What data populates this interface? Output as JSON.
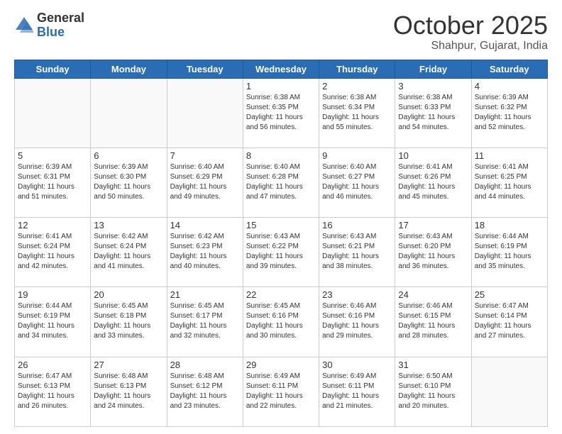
{
  "logo": {
    "general": "General",
    "blue": "Blue"
  },
  "header": {
    "month": "October 2025",
    "location": "Shahpur, Gujarat, India"
  },
  "days_of_week": [
    "Sunday",
    "Monday",
    "Tuesday",
    "Wednesday",
    "Thursday",
    "Friday",
    "Saturday"
  ],
  "weeks": [
    [
      {
        "day": "",
        "info": ""
      },
      {
        "day": "",
        "info": ""
      },
      {
        "day": "",
        "info": ""
      },
      {
        "day": "1",
        "info": "Sunrise: 6:38 AM\nSunset: 6:35 PM\nDaylight: 11 hours\nand 56 minutes."
      },
      {
        "day": "2",
        "info": "Sunrise: 6:38 AM\nSunset: 6:34 PM\nDaylight: 11 hours\nand 55 minutes."
      },
      {
        "day": "3",
        "info": "Sunrise: 6:38 AM\nSunset: 6:33 PM\nDaylight: 11 hours\nand 54 minutes."
      },
      {
        "day": "4",
        "info": "Sunrise: 6:39 AM\nSunset: 6:32 PM\nDaylight: 11 hours\nand 52 minutes."
      }
    ],
    [
      {
        "day": "5",
        "info": "Sunrise: 6:39 AM\nSunset: 6:31 PM\nDaylight: 11 hours\nand 51 minutes."
      },
      {
        "day": "6",
        "info": "Sunrise: 6:39 AM\nSunset: 6:30 PM\nDaylight: 11 hours\nand 50 minutes."
      },
      {
        "day": "7",
        "info": "Sunrise: 6:40 AM\nSunset: 6:29 PM\nDaylight: 11 hours\nand 49 minutes."
      },
      {
        "day": "8",
        "info": "Sunrise: 6:40 AM\nSunset: 6:28 PM\nDaylight: 11 hours\nand 47 minutes."
      },
      {
        "day": "9",
        "info": "Sunrise: 6:40 AM\nSunset: 6:27 PM\nDaylight: 11 hours\nand 46 minutes."
      },
      {
        "day": "10",
        "info": "Sunrise: 6:41 AM\nSunset: 6:26 PM\nDaylight: 11 hours\nand 45 minutes."
      },
      {
        "day": "11",
        "info": "Sunrise: 6:41 AM\nSunset: 6:25 PM\nDaylight: 11 hours\nand 44 minutes."
      }
    ],
    [
      {
        "day": "12",
        "info": "Sunrise: 6:41 AM\nSunset: 6:24 PM\nDaylight: 11 hours\nand 42 minutes."
      },
      {
        "day": "13",
        "info": "Sunrise: 6:42 AM\nSunset: 6:24 PM\nDaylight: 11 hours\nand 41 minutes."
      },
      {
        "day": "14",
        "info": "Sunrise: 6:42 AM\nSunset: 6:23 PM\nDaylight: 11 hours\nand 40 minutes."
      },
      {
        "day": "15",
        "info": "Sunrise: 6:43 AM\nSunset: 6:22 PM\nDaylight: 11 hours\nand 39 minutes."
      },
      {
        "day": "16",
        "info": "Sunrise: 6:43 AM\nSunset: 6:21 PM\nDaylight: 11 hours\nand 38 minutes."
      },
      {
        "day": "17",
        "info": "Sunrise: 6:43 AM\nSunset: 6:20 PM\nDaylight: 11 hours\nand 36 minutes."
      },
      {
        "day": "18",
        "info": "Sunrise: 6:44 AM\nSunset: 6:19 PM\nDaylight: 11 hours\nand 35 minutes."
      }
    ],
    [
      {
        "day": "19",
        "info": "Sunrise: 6:44 AM\nSunset: 6:19 PM\nDaylight: 11 hours\nand 34 minutes."
      },
      {
        "day": "20",
        "info": "Sunrise: 6:45 AM\nSunset: 6:18 PM\nDaylight: 11 hours\nand 33 minutes."
      },
      {
        "day": "21",
        "info": "Sunrise: 6:45 AM\nSunset: 6:17 PM\nDaylight: 11 hours\nand 32 minutes."
      },
      {
        "day": "22",
        "info": "Sunrise: 6:45 AM\nSunset: 6:16 PM\nDaylight: 11 hours\nand 30 minutes."
      },
      {
        "day": "23",
        "info": "Sunrise: 6:46 AM\nSunset: 6:16 PM\nDaylight: 11 hours\nand 29 minutes."
      },
      {
        "day": "24",
        "info": "Sunrise: 6:46 AM\nSunset: 6:15 PM\nDaylight: 11 hours\nand 28 minutes."
      },
      {
        "day": "25",
        "info": "Sunrise: 6:47 AM\nSunset: 6:14 PM\nDaylight: 11 hours\nand 27 minutes."
      }
    ],
    [
      {
        "day": "26",
        "info": "Sunrise: 6:47 AM\nSunset: 6:13 PM\nDaylight: 11 hours\nand 26 minutes."
      },
      {
        "day": "27",
        "info": "Sunrise: 6:48 AM\nSunset: 6:13 PM\nDaylight: 11 hours\nand 24 minutes."
      },
      {
        "day": "28",
        "info": "Sunrise: 6:48 AM\nSunset: 6:12 PM\nDaylight: 11 hours\nand 23 minutes."
      },
      {
        "day": "29",
        "info": "Sunrise: 6:49 AM\nSunset: 6:11 PM\nDaylight: 11 hours\nand 22 minutes."
      },
      {
        "day": "30",
        "info": "Sunrise: 6:49 AM\nSunset: 6:11 PM\nDaylight: 11 hours\nand 21 minutes."
      },
      {
        "day": "31",
        "info": "Sunrise: 6:50 AM\nSunset: 6:10 PM\nDaylight: 11 hours\nand 20 minutes."
      },
      {
        "day": "",
        "info": ""
      }
    ]
  ]
}
